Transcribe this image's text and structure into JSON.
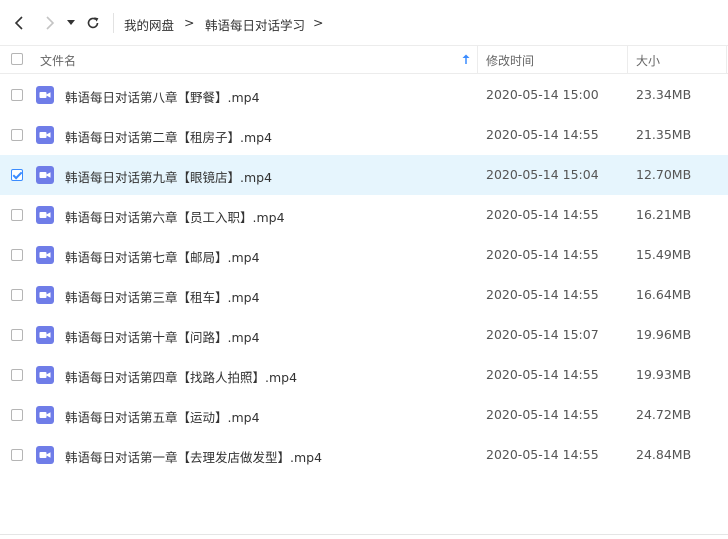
{
  "toolbar": {
    "back_icon": "arrow-left-icon",
    "forward_icon": "arrow-right-icon",
    "dropdown_icon": "caret-down-icon",
    "refresh_icon": "refresh-icon"
  },
  "breadcrumb": {
    "items": [
      "我的网盘",
      "韩语每日对话学习"
    ],
    "separator": ">"
  },
  "columns": {
    "name": "文件名",
    "modified": "修改时间",
    "size": "大小",
    "sort_icon": "sort-ascending-arrow-icon"
  },
  "colors": {
    "accent": "#3b8cff",
    "selected_row": "#e6f5fd",
    "video_icon": "#6f7de8"
  },
  "files": [
    {
      "name": "韩语每日对话第八章【野餐】.mp4",
      "modified": "2020-05-14 15:00",
      "size": "23.34MB",
      "selected": false
    },
    {
      "name": "韩语每日对话第二章【租房子】.mp4",
      "modified": "2020-05-14 14:55",
      "size": "21.35MB",
      "selected": false
    },
    {
      "name": "韩语每日对话第九章【眼镜店】.mp4",
      "modified": "2020-05-14 15:04",
      "size": "12.70MB",
      "selected": true
    },
    {
      "name": "韩语每日对话第六章【员工入职】.mp4",
      "modified": "2020-05-14 14:55",
      "size": "16.21MB",
      "selected": false
    },
    {
      "name": "韩语每日对话第七章【邮局】.mp4",
      "modified": "2020-05-14 14:55",
      "size": "15.49MB",
      "selected": false
    },
    {
      "name": "韩语每日对话第三章【租车】.mp4",
      "modified": "2020-05-14 14:55",
      "size": "16.64MB",
      "selected": false
    },
    {
      "name": "韩语每日对话第十章【问路】.mp4",
      "modified": "2020-05-14 15:07",
      "size": "19.96MB",
      "selected": false
    },
    {
      "name": "韩语每日对话第四章【找路人拍照】.mp4",
      "modified": "2020-05-14 14:55",
      "size": "19.93MB",
      "selected": false
    },
    {
      "name": "韩语每日对话第五章【运动】.mp4",
      "modified": "2020-05-14 14:55",
      "size": "24.72MB",
      "selected": false
    },
    {
      "name": "韩语每日对话第一章【去理发店做发型】.mp4",
      "modified": "2020-05-14 14:55",
      "size": "24.84MB",
      "selected": false
    }
  ]
}
